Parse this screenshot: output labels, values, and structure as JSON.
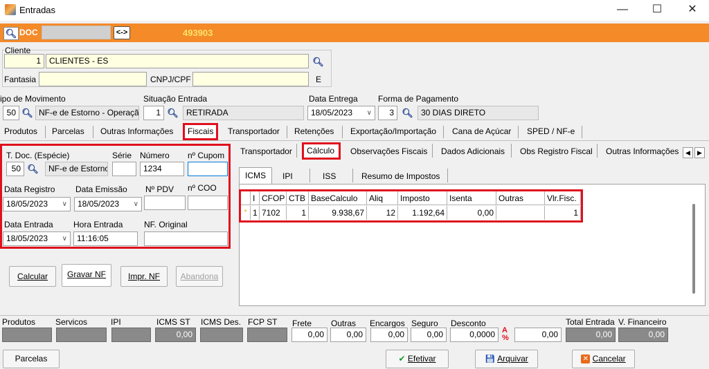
{
  "window": {
    "title": "Entradas",
    "minimize": "—",
    "maximize": "☐",
    "close": "✕"
  },
  "topbar": {
    "doc_label": "DOC",
    "swap_label": "<->",
    "doc_number": "493903"
  },
  "cliente": {
    "group_label": "Cliente",
    "code": "1",
    "name": "CLIENTES - ES",
    "fantasia_label": "Fantasia",
    "fantasia_value": "",
    "cnpj_label": "CNPJ/CPF",
    "cnpj_value": "",
    "uf": "E"
  },
  "movimento": {
    "tipo_label": "ipo  de Movimento",
    "tipo_code": "50",
    "tipo_desc": "NF-e de Estorno - Operaçã",
    "situacao_label": "Situação Entrada",
    "situacao_code": "1",
    "situacao_desc": "RETIRADA",
    "data_entrega_label": "Data Entrega",
    "data_entrega": "18/05/2023",
    "forma_pag_label": "Forma de Pagamento",
    "forma_pag_code": "3",
    "forma_pag_desc": "30 DIAS DIRETO"
  },
  "tabs": [
    "Produtos",
    "Parcelas",
    "Outras Informações",
    "Fiscais",
    "Transportador",
    "Retenções",
    "Exportação/Importação",
    "Cana de Açúcar",
    "SPED / NF-e"
  ],
  "fiscais": {
    "tdoc_label": "T. Doc. (Espécie)",
    "tdoc_code": "50",
    "tdoc_desc": "NF-e de Estorno",
    "serie_label": "Série",
    "serie_value": "",
    "numero_label": "Número",
    "numero_value": "1234",
    "cupom_label": "nº Cupom",
    "cupom_value": "",
    "data_registro_label": "Data Registro",
    "data_registro": "18/05/2023",
    "data_emissao_label": "Data Emissão",
    "data_emissao": "18/05/2023",
    "pdv_label": "Nº PDV",
    "pdv_value": "",
    "coo_label": "nº COO",
    "coo_value": "",
    "data_entrada_label": "Data Entrada",
    "data_entrada": "18/05/2023",
    "hora_entrada_label": "Hora Entrada",
    "hora_entrada": "11:16:05",
    "nf_original_label": "NF. Original",
    "nf_original": ""
  },
  "actions": {
    "calcular": "Calcular",
    "gravar": "Gravar NF",
    "imprimir": "Impr. NF",
    "abandona": "Abandona"
  },
  "subtabs": [
    "Transportador",
    "Cálculo",
    "Observações Fiscais",
    "Dados Adicionais",
    "Obs Registro Fiscal",
    "Outras Informações"
  ],
  "taxtabs": [
    "ICMS",
    "IPI",
    "ISS",
    "Resumo de Impostos"
  ],
  "grid": {
    "headers": [
      "I",
      "CFOP",
      "CTB",
      "BaseCalculo",
      "Aliq",
      "Imposto",
      "Isenta",
      "Outras",
      "Vlr.Fisc."
    ],
    "rows": [
      {
        "marker": "*",
        "i": "1",
        "cfop": "7102",
        "ctb": "1",
        "base": "9.938,67",
        "aliq": "12",
        "imposto": "1.192,64",
        "isenta": "0,00",
        "outras": "",
        "vlr": "1"
      }
    ]
  },
  "totals": {
    "labels": [
      "Produtos",
      "Servicos",
      "IPI",
      "ICMS ST",
      "ICMS Des.",
      "FCP ST",
      "Frete",
      "Outras",
      "Encargos",
      "Seguro",
      "Desconto",
      "Total Entrada",
      "V. Financeiro"
    ],
    "icms_st": "0,00",
    "frete": "0,00",
    "outras": "0,00",
    "encargos": "0,00",
    "seguro": "0,00",
    "desconto_pct": "0,0000",
    "desconto_val": "0,00",
    "total_entrada": "0,00",
    "v_financeiro": "0,00"
  },
  "bottom": {
    "parcelas": "Parcelas",
    "efetivar": "Efetivar",
    "arquivar": "Arquivar",
    "cancelar": "Cancelar"
  },
  "colors": {
    "accent_orange": "#f48a28",
    "highlight_red": "#e0101e",
    "yellow_field": "#ffffe1"
  }
}
